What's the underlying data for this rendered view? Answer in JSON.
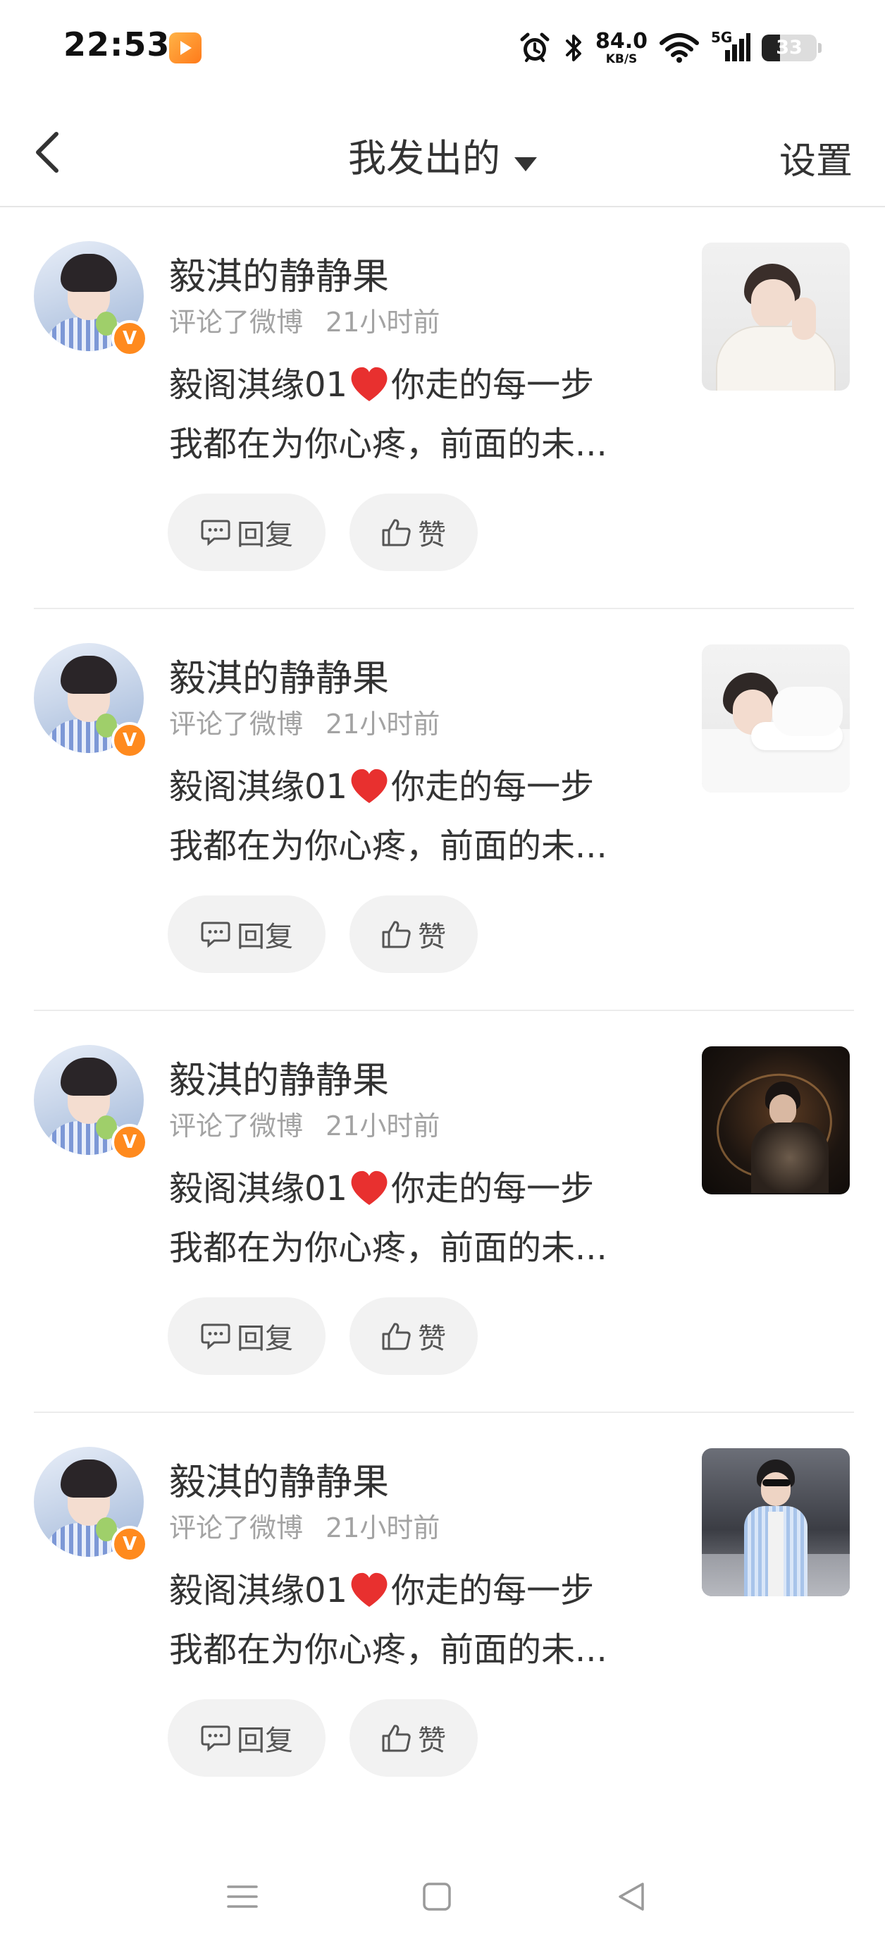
{
  "status_bar": {
    "time": "22:53",
    "net_speed_value": "84.0",
    "net_speed_unit": "KB/S",
    "network_type": "5G",
    "battery_level": "33",
    "battery_percent": 33,
    "icons": [
      "alarm-icon",
      "bluetooth-icon",
      "wifi-icon",
      "cellular-signal-icon",
      "battery-icon"
    ]
  },
  "header": {
    "title": "我发出的",
    "settings_label": "设置",
    "back_icon": "chevron-left-icon",
    "dropdown_icon": "caret-down-icon"
  },
  "feed": {
    "items": [
      {
        "username": "毅淇的静静果",
        "action": "评论了微博",
        "time_ago": "21小时前",
        "content_before_emoji": "毅阁淇缘01",
        "emoji": "red-heart",
        "content_after_emoji": "你走的每一步",
        "content_line2": "我都在为你心疼，前面的未...",
        "reply_label": "回复",
        "like_label": "赞",
        "verified": "V"
      },
      {
        "username": "毅淇的静静果",
        "action": "评论了微博",
        "time_ago": "21小时前",
        "content_before_emoji": "毅阁淇缘01",
        "emoji": "red-heart",
        "content_after_emoji": "你走的每一步",
        "content_line2": "我都在为你心疼，前面的未...",
        "reply_label": "回复",
        "like_label": "赞",
        "verified": "V"
      },
      {
        "username": "毅淇的静静果",
        "action": "评论了微博",
        "time_ago": "21小时前",
        "content_before_emoji": "毅阁淇缘01",
        "emoji": "red-heart",
        "content_after_emoji": "你走的每一步",
        "content_line2": "我都在为你心疼，前面的未...",
        "reply_label": "回复",
        "like_label": "赞",
        "verified": "V"
      },
      {
        "username": "毅淇的静静果",
        "action": "评论了微博",
        "time_ago": "21小时前",
        "content_before_emoji": "毅阁淇缘01",
        "emoji": "red-heart",
        "content_after_emoji": "你走的每一步",
        "content_line2": "我都在为你心疼，前面的未...",
        "reply_label": "回复",
        "like_label": "赞",
        "verified": "V"
      }
    ]
  },
  "colors": {
    "accent_orange": "#ff8a1e",
    "heart_red": "#e8302f",
    "text_primary": "#333333",
    "text_secondary": "#a3a3a3",
    "pill_bg": "#f2f2f2"
  },
  "nav_bar": {
    "icons": [
      "menu-icon",
      "home-square-icon",
      "back-triangle-icon"
    ]
  }
}
